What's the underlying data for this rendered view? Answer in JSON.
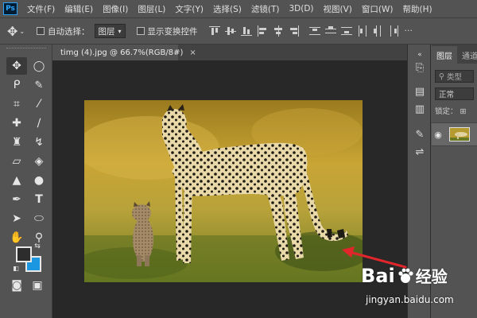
{
  "app": {
    "logo": "Ps"
  },
  "menu": [
    "文件(F)",
    "编辑(E)",
    "图像(I)",
    "图层(L)",
    "文字(Y)",
    "选择(S)",
    "滤镜(T)",
    "3D(D)",
    "视图(V)",
    "窗口(W)",
    "帮助(H)"
  ],
  "options": {
    "auto_select_label": "自动选择：",
    "auto_select_value": "图层",
    "show_transform_label": "显示变换控件"
  },
  "document": {
    "tab_title": "timg (4).jpg @ 66.7%(RGB/8#)",
    "close": "×"
  },
  "colors": {
    "foreground": "#2d2d2d",
    "background": "#1b96e0",
    "arrow": "#e0262b"
  },
  "panel": {
    "tabs": [
      "图层",
      "通道"
    ],
    "search_placeholder": "类型",
    "blend_mode": "正常",
    "lock_label": "锁定："
  },
  "watermark": {
    "brand_a": "Bai",
    "brand_b": "经验",
    "url": "jingyan.baidu.com"
  }
}
